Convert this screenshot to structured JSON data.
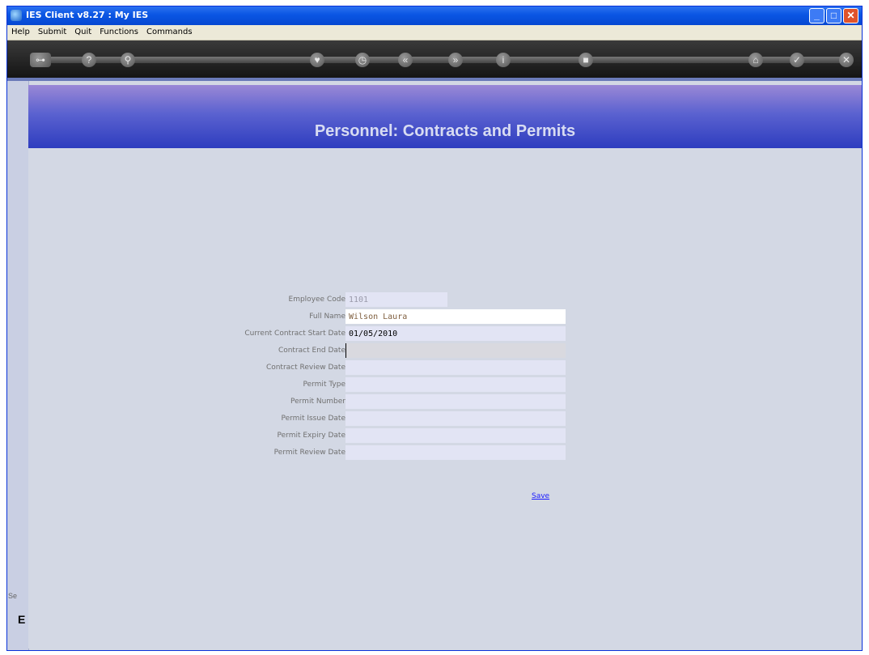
{
  "window": {
    "title": "IES Client v8.27 : My IES"
  },
  "menu": [
    "Help",
    "Submit",
    "Quit",
    "Functions",
    "Commands"
  ],
  "toolbar_icons": [
    "key-icon",
    "help-icon",
    "search-icon",
    "heart-icon",
    "clock-icon",
    "rewind-icon",
    "forward-icon",
    "info-icon",
    "stop-icon",
    "home-icon",
    "check-icon",
    "close-icon"
  ],
  "page": {
    "title": "Personnel: Contracts and Permits"
  },
  "form": {
    "employee_code_label": "Employee Code",
    "employee_code_value": "1101",
    "full_name_label": "Full Name",
    "full_name_value": "Wilson Laura",
    "contract_start_label": "Current Contract Start Date",
    "contract_start_value": "01/05/2010",
    "contract_end_label": "Contract End Date",
    "contract_end_value": "",
    "contract_review_label": "Contract Review Date",
    "contract_review_value": "",
    "permit_type_label": "Permit Type",
    "permit_type_value": "",
    "permit_number_label": "Permit Number",
    "permit_number_value": "",
    "permit_issue_label": "Permit Issue Date",
    "permit_issue_value": "",
    "permit_expiry_label": "Permit Expiry Date",
    "permit_expiry_value": "",
    "permit_review_label": "Permit Review Date",
    "permit_review_value": "",
    "save_label": "Save"
  },
  "sidebar": {
    "fragment_text": "Se",
    "fragment_letter": "E"
  }
}
